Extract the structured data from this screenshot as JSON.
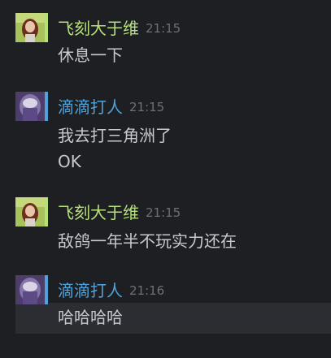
{
  "colors": {
    "background": "#1e1f23",
    "name_green": "#b7e07a",
    "name_blue": "#4fa3db",
    "timestamp": "#6d7078",
    "message_text": "#c7c9cf",
    "hover_row": "#2b2d33"
  },
  "messages": [
    {
      "author": "飞刻大于维",
      "time": "21:15",
      "lines": [
        "休息一下"
      ]
    },
    {
      "author": "滴滴打人",
      "time": "21:15",
      "lines": [
        "我去打三角洲了",
        "OK"
      ]
    },
    {
      "author": "飞刻大于维",
      "time": "21:15",
      "lines": [
        "敌鸽一年半不玩实力还在"
      ]
    },
    {
      "author": "滴滴打人",
      "time": "21:16",
      "lines": [
        "哈哈哈哈"
      ]
    }
  ]
}
